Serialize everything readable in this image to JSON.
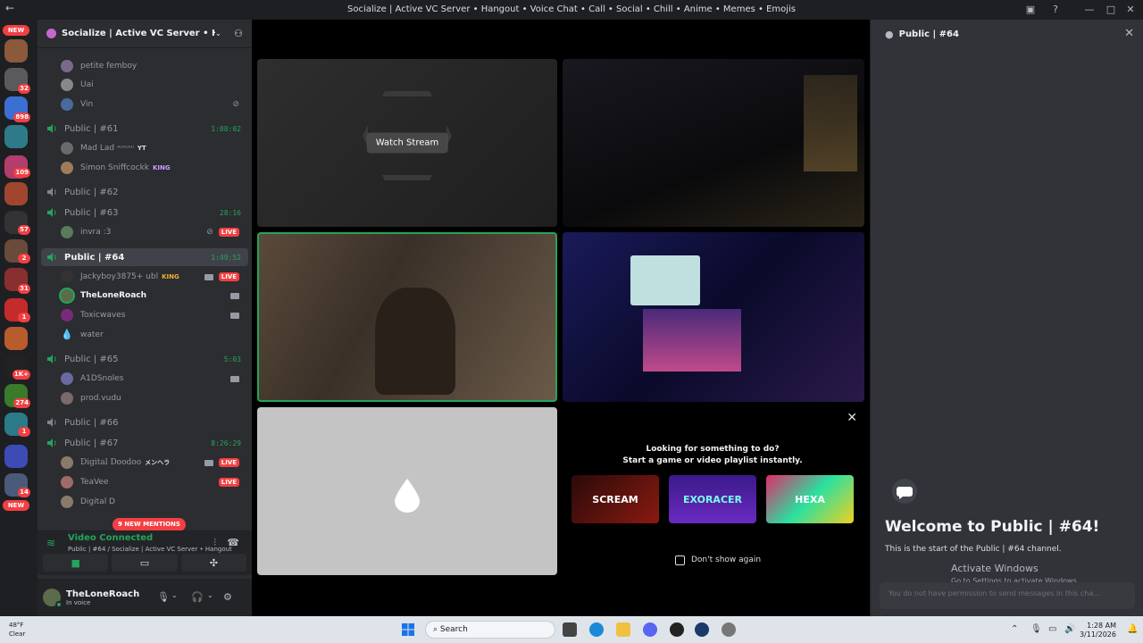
{
  "window": {
    "title": "Socialize | Active VC Server • Hangout • Voice Chat • Call • Social • Chill • Anime • Memes • Emojis"
  },
  "rail": {
    "badges": [
      "32",
      "898",
      "109",
      "57",
      "2",
      "31",
      "1",
      "1K+",
      "274",
      "1",
      "14"
    ],
    "new_top": "NEW",
    "new_bottom": "NEW"
  },
  "server": {
    "name": "Socialize | Active VC Server • Han..."
  },
  "channels": {
    "top_users": [
      "petite femboy",
      "Uai",
      "Vin"
    ],
    "items": [
      {
        "name": "Public | #61",
        "time": "1:08:02",
        "users": [
          {
            "name": "Mad Lad",
            "suffix": "ᴬᵁᴬᵁᴬᵁ",
            "tag": "YT"
          },
          {
            "name": "Simon Sniffcockk",
            "tag": "KING"
          }
        ]
      },
      {
        "name": "Public | #62",
        "time": "",
        "users": []
      },
      {
        "name": "Public | #63",
        "time": "28:16",
        "users": [
          {
            "name": "invra :3",
            "tag": ""
          }
        ]
      },
      {
        "name": "Public | #64",
        "time": "1:49:52",
        "users": [
          {
            "name": "Jackyboy3875+ ubl",
            "tag": "KING"
          },
          {
            "name": "TheLoneRoach",
            "tag": ""
          },
          {
            "name": "Toxicwaves",
            "tag": ""
          },
          {
            "name": "water",
            "tag": ""
          }
        ]
      },
      {
        "name": "Public | #65",
        "time": "5:03",
        "users": [
          {
            "name": "A1DSnoles",
            "tag": ""
          },
          {
            "name": "prod.vudu",
            "tag": ""
          }
        ]
      },
      {
        "name": "Public | #66",
        "time": "",
        "users": []
      },
      {
        "name": "Public | #67",
        "time": "8:26:29",
        "users": [
          {
            "name": "Digital Doodoo",
            "tag": "メンヘラ"
          },
          {
            "name": "TeaVee",
            "tag": ""
          },
          {
            "name": "Digital D",
            "tag": ""
          }
        ]
      }
    ],
    "live_label": "LIVE",
    "mentions": "9 NEW MENTIONS"
  },
  "voice": {
    "status": "Video Connected",
    "location": "Public | #64 / Socialize | Active VC Server • Hangout..."
  },
  "user": {
    "name": "TheLoneRoach",
    "status": "In voice"
  },
  "stage": {
    "watch_stream": "Watch Stream",
    "picker_line1": "Looking for something to do?",
    "picker_line2": "Start a game or video playlist instantly.",
    "games": [
      "SCREAM",
      "EXORACER",
      "HEXA"
    ],
    "dont_show": "Don't show again"
  },
  "chat": {
    "header": "Public | #64",
    "welcome": "Welcome to Public | #64!",
    "start": "This is the start of the Public | #64 channel.",
    "activate_title": "Activate Windows",
    "activate_sub": "Go to Settings to activate Windows.",
    "no_permission": "You do not have permission to send messages in this cha..."
  },
  "taskbar": {
    "temp": "48°F",
    "weather": "Clear",
    "search": "Search",
    "time": "1:28 AM",
    "date": "3/11/2026"
  },
  "colors": {
    "green": "#23a55a",
    "red": "#f23f43",
    "sidebar": "#2b2d31",
    "chat": "#313338"
  }
}
